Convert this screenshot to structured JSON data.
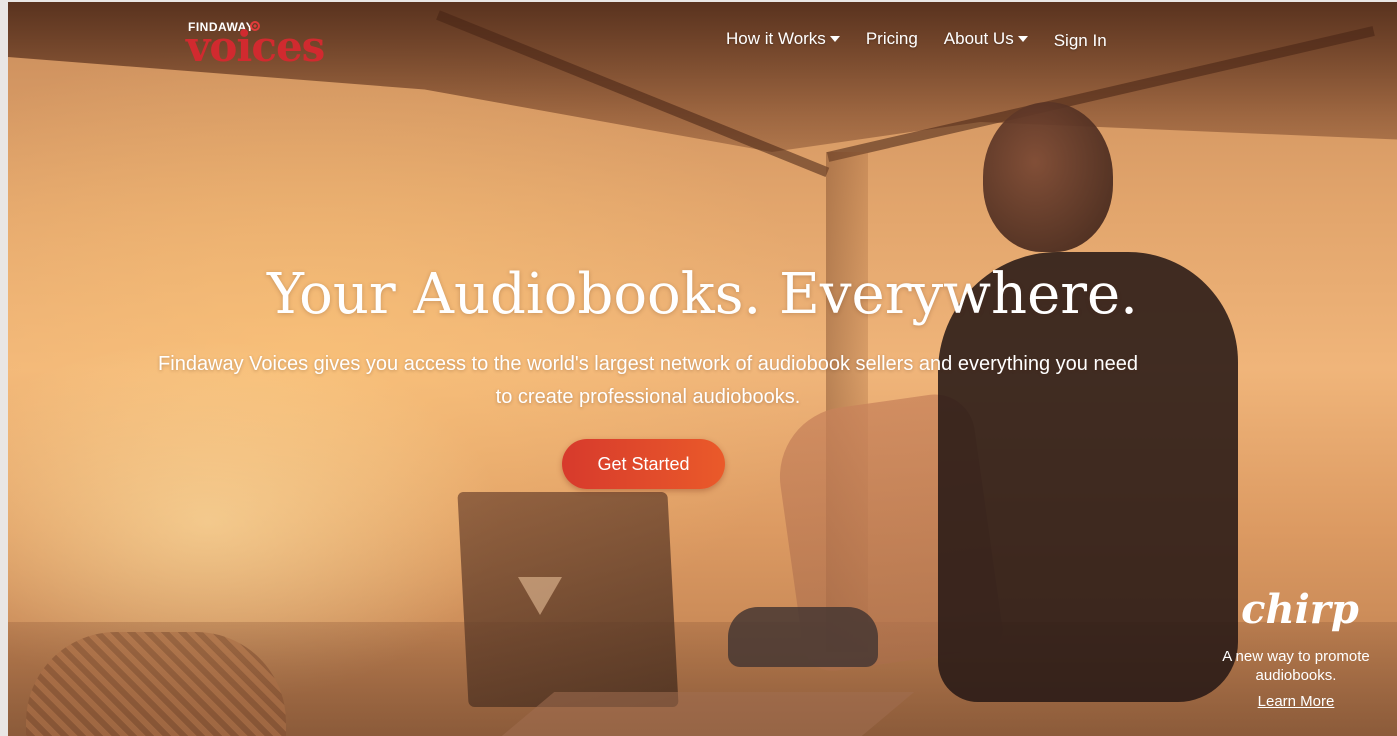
{
  "brand": {
    "logo_small": "FINDAWAY",
    "logo_big": "voices",
    "logo_color": "#d12a2f"
  },
  "nav": {
    "items": [
      {
        "label": "How it Works",
        "has_dropdown": true
      },
      {
        "label": "Pricing",
        "has_dropdown": false
      },
      {
        "label": "About Us",
        "has_dropdown": true
      },
      {
        "label": "Sign In",
        "has_dropdown": false
      }
    ]
  },
  "hero": {
    "title": "Your Audiobooks. Everywhere.",
    "subtitle_line1": "Findaway Voices gives you access to the world's largest network of audiobook sellers and everything you need",
    "subtitle_line2": "to create professional audiobooks.",
    "cta_label": "Get Started",
    "cta_color": "#e0462b"
  },
  "promo": {
    "logo": "chirp",
    "text_line1": "A new way to promote",
    "text_line2": "audiobooks.",
    "link_label": "Learn More"
  }
}
